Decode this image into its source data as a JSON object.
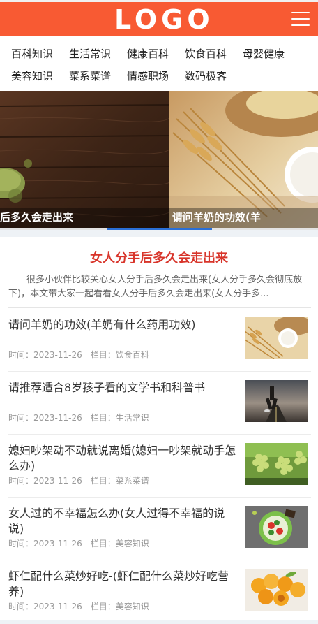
{
  "header": {
    "logo_text": "LOGO",
    "brand_color": "#f85a33",
    "menu_icon": "hamburger-menu-icon"
  },
  "nav": {
    "items": [
      {
        "label": "百科知识"
      },
      {
        "label": "生活常识"
      },
      {
        "label": "健康百科"
      },
      {
        "label": "饮食百科"
      },
      {
        "label": "母婴健康"
      },
      {
        "label": "美容知识"
      },
      {
        "label": "菜系菜谱"
      },
      {
        "label": "情感职场"
      },
      {
        "label": "数码极客"
      }
    ]
  },
  "slider": {
    "slides": [
      {
        "caption": "后多久会走出来",
        "image": "wooden-table-with-matcha-powder"
      },
      {
        "caption": "请问羊奶的功效(羊",
        "image": "wheat-and-milk-cup"
      }
    ],
    "active_index": 1,
    "total": 3
  },
  "featured": {
    "title": "女人分手后多久会走出来",
    "description": "很多小伙伴比较关心女人分手后多久会走出来(女人分手多久会彻底放下)，本文带大家一起看看女人分手后多久会走出来(女人分手多..."
  },
  "meta_labels": {
    "time": "时间：",
    "column": "栏目："
  },
  "news": [
    {
      "title": "请问羊奶的功效(羊奶有什么药用功效)",
      "date": "2023-11-26",
      "category": "饮食百科",
      "thumb": "wheat-and-milk-thumbnail"
    },
    {
      "title": "请推荐适合8岁孩子看的文学书和科普书",
      "date": "2023-11-26",
      "category": "生活常识",
      "thumb": "running-on-road-thumbnail"
    },
    {
      "title": "媳妇吵架动不动就说离婚(媳妇一吵架就动手怎么办)",
      "date": "2023-11-26",
      "category": "菜系菜谱",
      "thumb": "green-grapes-thumbnail"
    },
    {
      "title": "女人过的不幸福怎么办(女人过得不幸福的说说)",
      "date": "2023-11-26",
      "category": "美容知识",
      "thumb": "salad-plate-thumbnail"
    },
    {
      "title": "虾仁配什么菜炒好吃-(虾仁配什么菜炒好吃营养)",
      "date": "2023-11-26",
      "category": "美容知识",
      "thumb": "apricots-thumbnail"
    }
  ]
}
